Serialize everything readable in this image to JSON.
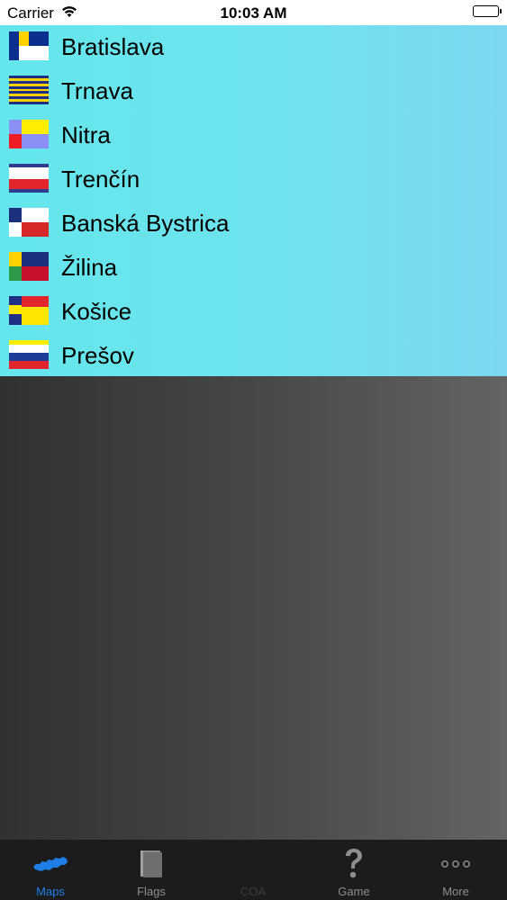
{
  "status_bar": {
    "carrier": "Carrier",
    "time": "10:03 AM"
  },
  "regions": [
    {
      "name": "Bratislava"
    },
    {
      "name": "Trnava"
    },
    {
      "name": "Nitra"
    },
    {
      "name": "Trenčín"
    },
    {
      "name": "Banská Bystrica"
    },
    {
      "name": "Žilina"
    },
    {
      "name": "Košice"
    },
    {
      "name": "Prešov"
    }
  ],
  "tab_bar": {
    "tabs": [
      {
        "label": "Maps",
        "icon": "slovakia-map-icon",
        "state": "active"
      },
      {
        "label": "Flags",
        "icon": "flags-book-icon",
        "state": "normal"
      },
      {
        "label": "COA",
        "icon": "coat-of-arms-icon",
        "state": "disabled"
      },
      {
        "label": "Game",
        "icon": "question-mark-icon",
        "state": "normal"
      },
      {
        "label": "More",
        "icon": "more-dots-icon",
        "state": "normal"
      }
    ]
  },
  "colors": {
    "accent": "#1f7ee6",
    "tab_inactive": "#8e8e8e",
    "list_background": "#6ee3ee",
    "tab_bar_background": "#1c1c1c"
  }
}
